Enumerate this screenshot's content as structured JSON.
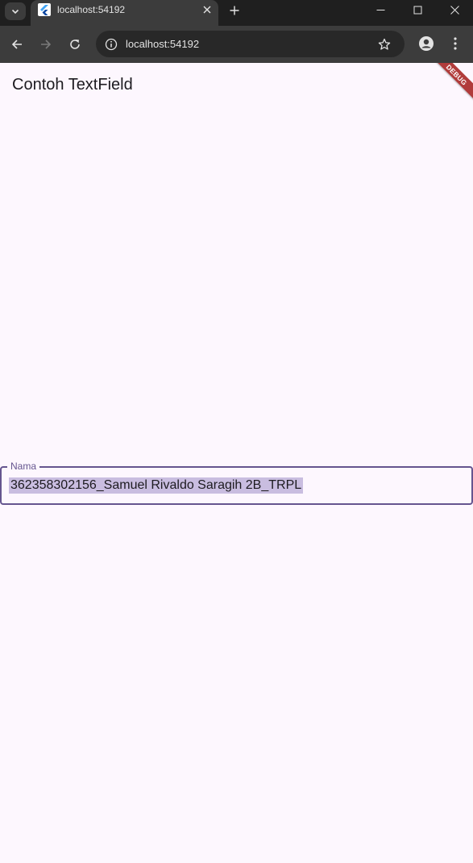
{
  "browser": {
    "tab_title": "localhost:54192",
    "url": "localhost:54192"
  },
  "app": {
    "title": "Contoh TextField",
    "debug_banner": "DEBUG"
  },
  "textfield": {
    "label": "Nama",
    "value": "362358302156_Samuel Rivaldo Saragih 2B_TRPL"
  },
  "colors": {
    "accent": "#65558f",
    "background": "#fdf7fe",
    "selection": "#c9bde0",
    "debug": "#b13b3b"
  }
}
